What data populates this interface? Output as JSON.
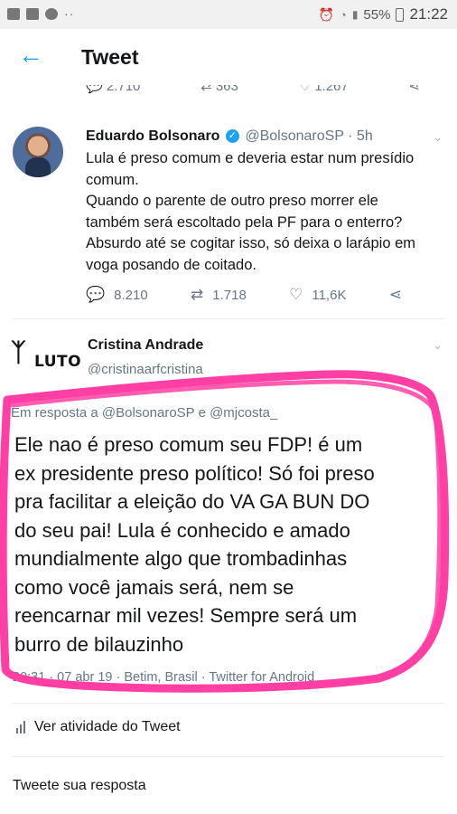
{
  "status_bar": {
    "battery_percent": "55%",
    "time": "21:22",
    "dots": "··"
  },
  "header": {
    "back_icon": "←",
    "title": "Tweet"
  },
  "previous_tweet_actions": {
    "replies": "2.710",
    "retweets": "363",
    "likes": "1.267"
  },
  "main_tweet": {
    "author_name": "Eduardo Bolsonaro",
    "verified_icon": "✓",
    "handle_time": "@BolsonaroSP · 5h",
    "text_lines": [
      "Lula é preso comum e deveria estar num presídio",
      "comum.",
      "Quando o parente de outro preso morrer ele",
      "também será escoltado pela PF para o enterro?",
      "Absurdo até se cogitar isso, só deixa o larápio em",
      "voga posando de coitado."
    ],
    "replies": "8.210",
    "retweets": "1.718",
    "likes": "11,6K"
  },
  "reply_tweet": {
    "badge_text": "LUTO",
    "author_name": "Cristina Andrade",
    "handle": "@cristinaarfcristina",
    "reply_prefix": "Em resposta a",
    "reply_mentions": "@BolsonaroSP e @mjcosta_",
    "text_lines": [
      "Ele nao é preso comum seu FDP! é um",
      "ex presidente preso político! Só foi preso",
      "pra facilitar a eleição do VA GA BUN DO",
      "do seu pai! Lula é conhecido e amado",
      "mundialmente algo que trombadinhas",
      "como você jamais será, nem se",
      "reencarnar mil vezes! Sempre será um",
      "burro de bilauzinho"
    ],
    "meta": "20:31 · 07 abr 19 · Betim, Brasil · Twitter for Android"
  },
  "footer": {
    "activity_label": "Ver atividade do Tweet",
    "compose_placeholder": "Tweete sua resposta"
  },
  "colors": {
    "accent": "#1da1f2",
    "highlight": "#ff3fa4",
    "muted": "#657786"
  }
}
